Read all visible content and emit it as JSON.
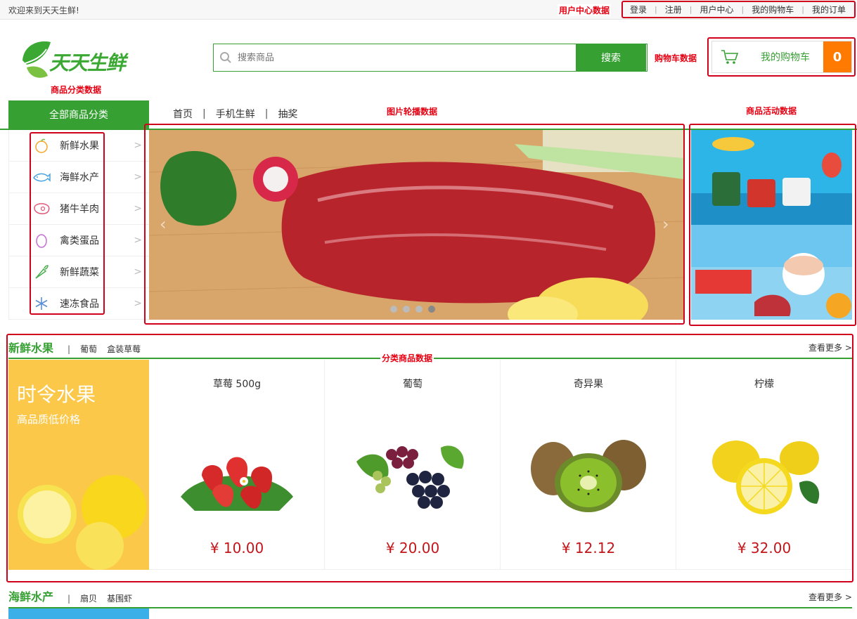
{
  "topbar": {
    "welcome": "欢迎来到天天生鲜!",
    "links": [
      "登录",
      "注册",
      "用户中心",
      "我的购物车",
      "我的订单"
    ]
  },
  "annotations": {
    "user_center": "用户中心数据",
    "cart": "购物车数据",
    "category": "商品分类数据",
    "carousel": "图片轮播数据",
    "activity": "商品活动数据",
    "category_goods": "分类商品数据"
  },
  "logo": {
    "text": "天天生鲜"
  },
  "search": {
    "placeholder": "搜索商品",
    "button": "搜索"
  },
  "cart": {
    "label": "我的购物车",
    "count": "0"
  },
  "nav": {
    "all_categories": "全部商品分类",
    "items": [
      "首页",
      "手机生鲜",
      "抽奖"
    ]
  },
  "categories": [
    {
      "label": "新鲜水果",
      "icon": "fruit-icon"
    },
    {
      "label": "海鲜水产",
      "icon": "seafood-icon"
    },
    {
      "label": "猪牛羊肉",
      "icon": "meat-icon"
    },
    {
      "label": "禽类蛋品",
      "icon": "egg-icon"
    },
    {
      "label": "新鲜蔬菜",
      "icon": "vegetable-icon"
    },
    {
      "label": "速冻食品",
      "icon": "frozen-icon"
    }
  ],
  "carousel": {
    "slides": 4,
    "active_index": 3
  },
  "sections": [
    {
      "title": "新鲜水果",
      "links": [
        "葡萄",
        "盒装草莓"
      ],
      "more": "查看更多 >",
      "promo_title": "时令水果",
      "promo_subtitle": "高品质低价格",
      "products": [
        {
          "name": "草莓 500g",
          "price": "¥ 10.00",
          "icon": "strawberry-image"
        },
        {
          "name": "葡萄",
          "price": "¥ 20.00",
          "icon": "grape-image"
        },
        {
          "name": "奇异果",
          "price": "¥ 12.12",
          "icon": "kiwi-image"
        },
        {
          "name": "柠檬",
          "price": "¥ 32.00",
          "icon": "lemon-image"
        }
      ]
    },
    {
      "title": "海鲜水产",
      "links": [
        "扇贝",
        "基围虾"
      ],
      "more": "查看更多 >"
    }
  ],
  "colors": {
    "brand_green": "#37a033",
    "cart_orange": "#ff7a00",
    "price_red": "#c2161a",
    "annotation_red": "#d0021b"
  }
}
